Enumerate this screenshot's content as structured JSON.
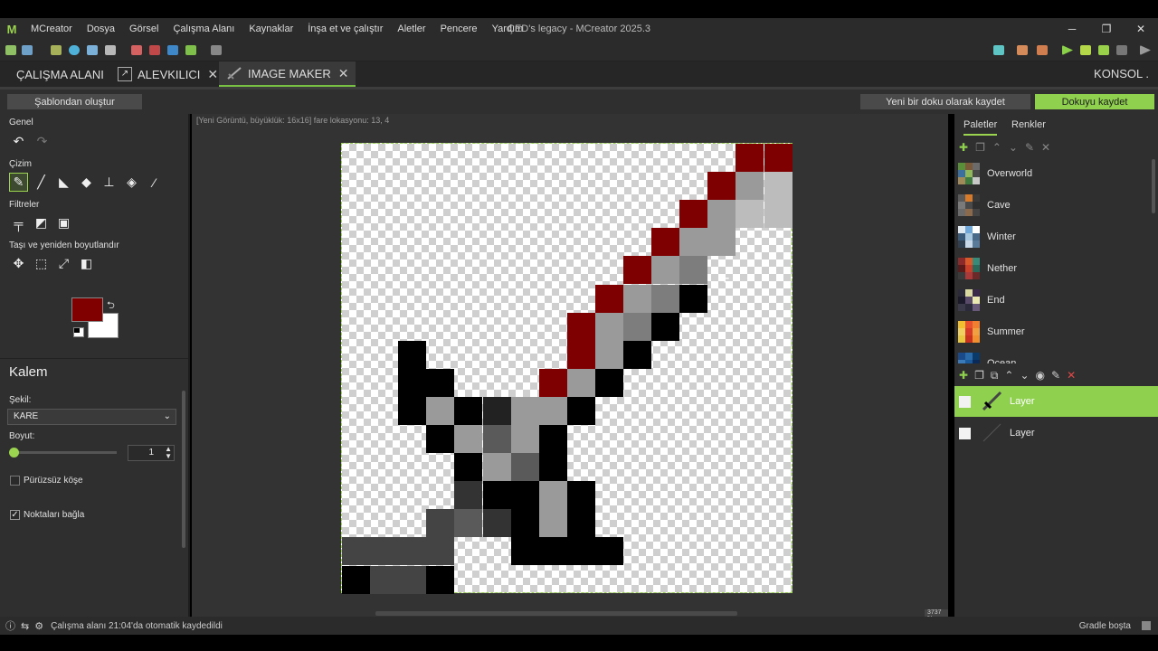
{
  "titlebar": {
    "menus": [
      "MCreator",
      "Dosya",
      "Görsel",
      "Çalışma Alanı",
      "Kaynaklar",
      "İnşa et ve çalıştır",
      "Aletler",
      "Pencere",
      "Yardım"
    ],
    "title": "ÇED's legacy - MCreator 2025.3"
  },
  "tabs": {
    "workspace": "ÇALIŞMA ALANI",
    "tab1": "ALEVKILICI",
    "tab2": "IMAGE MAKER",
    "console": "KONSOL"
  },
  "actions": {
    "from_template": "Şablondan oluştur",
    "save_as_new": "Yeni bir doku olarak kaydet",
    "save": "Dokuyu kaydet"
  },
  "left": {
    "general": "Genel",
    "drawing": "Çizim",
    "filters": "Filtreler",
    "move_resize": "Taşı ve yeniden boyutlandır",
    "tool_name": "Kalem",
    "shape_label": "Şekil:",
    "shape_value": "KARE",
    "size_label": "Boyut:",
    "size_value": "1",
    "smooth_label": "Pürüzsüz köşe",
    "connect_label": "Noktaları bağla",
    "smooth_checked": false,
    "connect_checked": true,
    "primary_color": "#800000",
    "secondary_color": "#ffffff"
  },
  "canvas": {
    "info": "[Yeni Görüntü, büyüklük: 16x16] fare lokasyonu: 13, 4",
    "zoom": "3737 %"
  },
  "right": {
    "tab_palettes": "Paletler",
    "tab_colors": "Renkler",
    "palettes": [
      "Overworld",
      "Cave",
      "Winter",
      "Nether",
      "End",
      "Summer",
      "Ocean"
    ],
    "layers": [
      "Layer",
      "Layer"
    ]
  },
  "status": {
    "autosave": "Çalışma alanı 21:04'da otomatik kaydedildi",
    "gradle": "Gradle boşta"
  }
}
